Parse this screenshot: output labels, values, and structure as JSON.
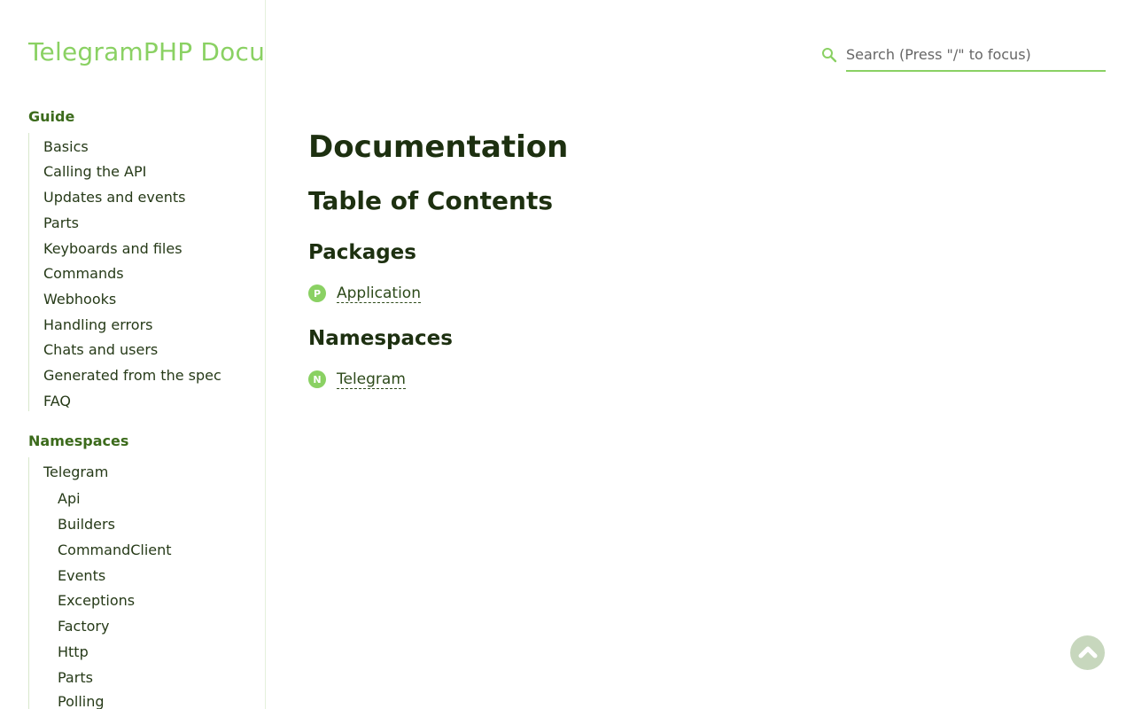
{
  "site": {
    "title": "TelegramPHP Documentation"
  },
  "search": {
    "placeholder": "Search (Press \"/\" to focus)",
    "value": ""
  },
  "sidebar": {
    "guide_title": "Guide",
    "guide_items": [
      {
        "label": "Basics"
      },
      {
        "label": "Calling the API"
      },
      {
        "label": "Updates and events"
      },
      {
        "label": "Parts"
      },
      {
        "label": "Keyboards and files"
      },
      {
        "label": "Commands"
      },
      {
        "label": "Webhooks"
      },
      {
        "label": "Handling errors"
      },
      {
        "label": "Chats and users"
      },
      {
        "label": "Generated from the spec"
      },
      {
        "label": "FAQ"
      }
    ],
    "namespaces_title": "Namespaces",
    "namespace_root": "Telegram",
    "namespace_children": [
      {
        "label": "Api"
      },
      {
        "label": "Builders"
      },
      {
        "label": "CommandClient"
      },
      {
        "label": "Events"
      },
      {
        "label": "Exceptions"
      },
      {
        "label": "Factory"
      },
      {
        "label": "Http"
      },
      {
        "label": "Parts"
      },
      {
        "label": "Polling"
      }
    ]
  },
  "main": {
    "heading": "Documentation",
    "toc_heading": "Table of Contents",
    "packages_heading": "Packages",
    "packages": [
      {
        "badge": "P",
        "label": "Application"
      }
    ],
    "namespaces_heading": "Namespaces",
    "namespaces": [
      {
        "badge": "N",
        "label": "Telegram"
      }
    ]
  },
  "colors": {
    "accent": "#8ad163",
    "heading": "#1d3010",
    "section_title": "#3c6b1c",
    "back_to_top": "#c7d7bd"
  },
  "icons": {
    "search": "search-icon",
    "back_to_top": "chevron-up-icon"
  }
}
